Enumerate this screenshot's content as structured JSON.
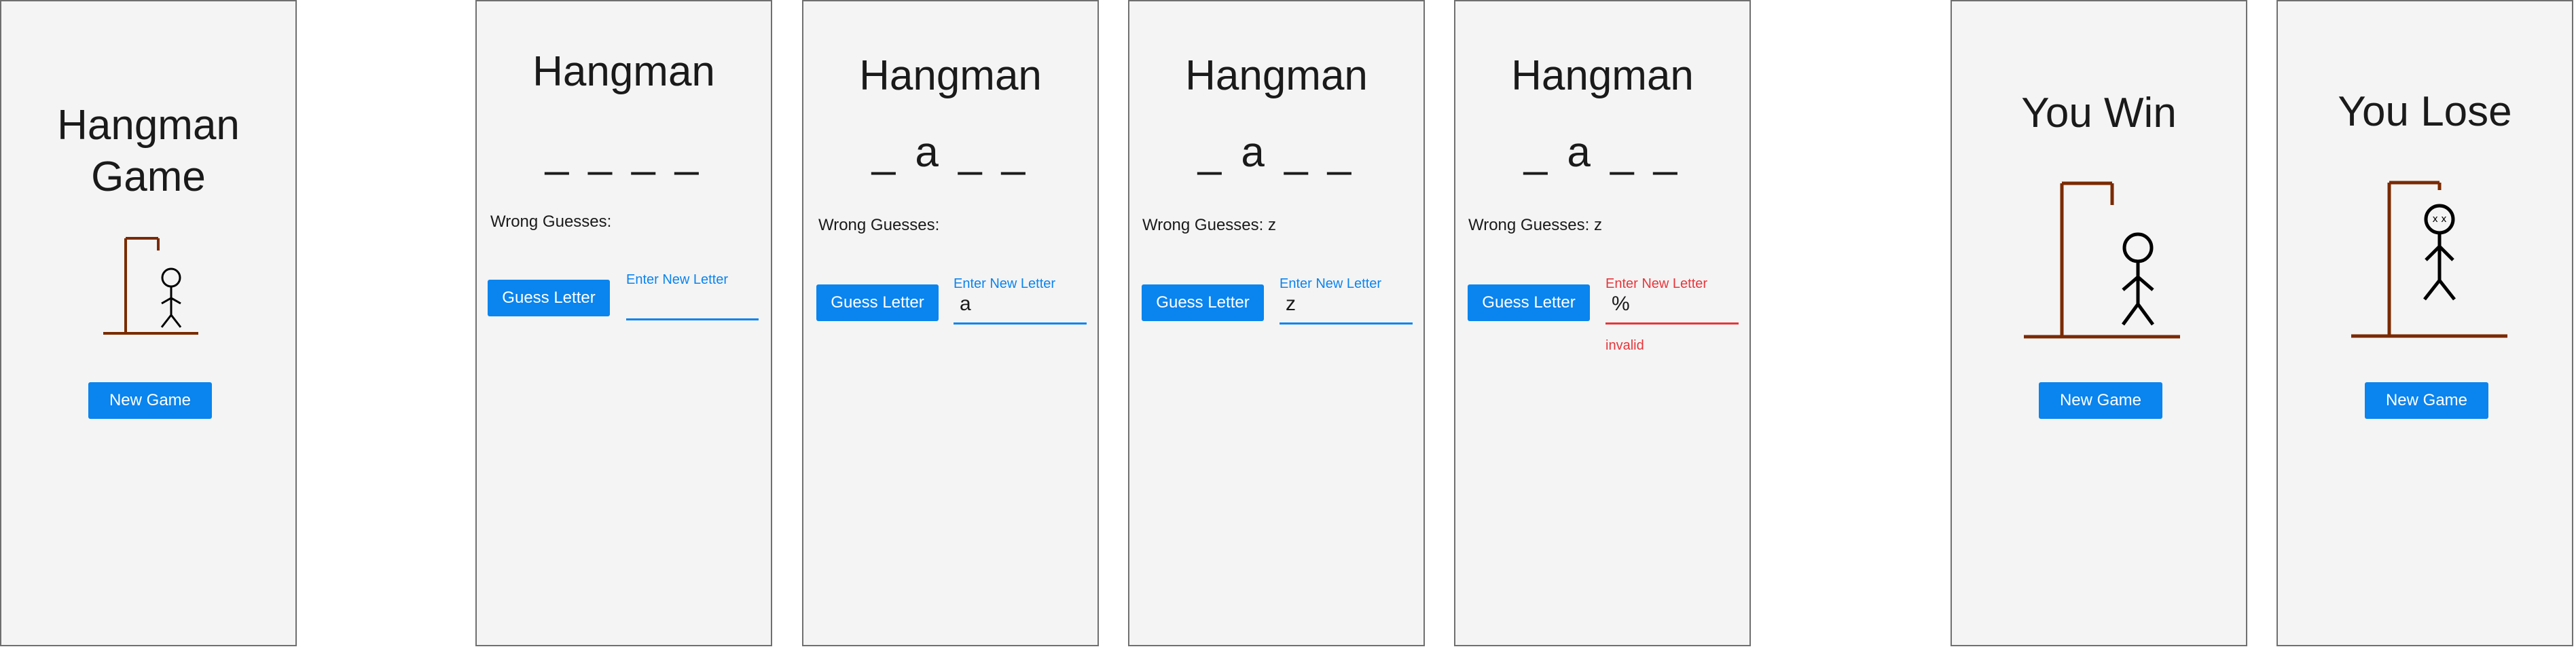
{
  "colors": {
    "accent": "#0a84ee",
    "error": "#e8353a",
    "gallows": "#7a2a00",
    "panel": "#f4f4f4"
  },
  "start": {
    "title_line1": "Hangman",
    "title_line2": "Game",
    "button": "New Game"
  },
  "play1": {
    "title": "Hangman",
    "word": "_ _ _ _",
    "wrong": "Wrong Guesses:",
    "button": "Guess Letter",
    "field_label": "Enter New Letter",
    "field_value": ""
  },
  "play2": {
    "title": "Hangman",
    "word": "_ a _ _",
    "wrong": "Wrong Guesses:",
    "button": "Guess Letter",
    "field_label": "Enter New Letter",
    "field_value": "a"
  },
  "play3": {
    "title": "Hangman",
    "word": "_ a _ _",
    "wrong": "Wrong Guesses: z",
    "button": "Guess Letter",
    "field_label": "Enter New Letter",
    "field_value": "z"
  },
  "play4": {
    "title": "Hangman",
    "word": "_ a _ _",
    "wrong": "Wrong Guesses: z",
    "button": "Guess Letter",
    "field_label": "Enter New Letter",
    "field_value": "%",
    "error": "invalid"
  },
  "win": {
    "title": "You Win",
    "button": "New Game"
  },
  "lose": {
    "title": "You Lose",
    "button": "New Game",
    "face": "x x"
  }
}
